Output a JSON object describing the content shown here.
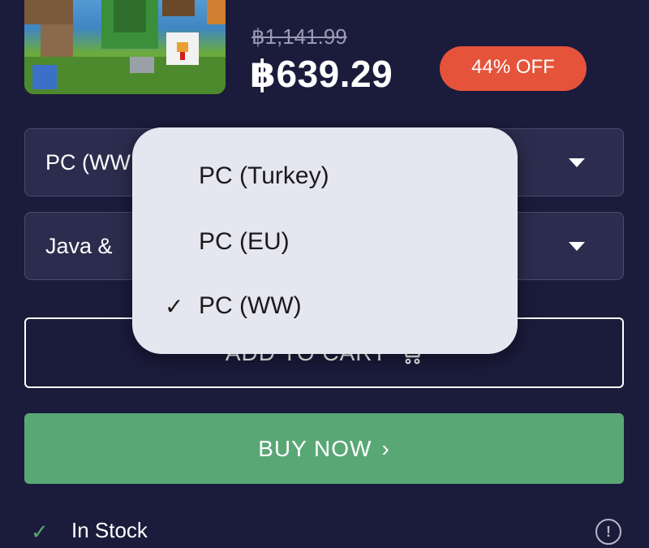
{
  "product": {
    "old_price": "฿1,141.99",
    "price": "฿639.29",
    "discount_label": "44% OFF"
  },
  "platform_select": {
    "value": "PC (WW"
  },
  "edition_select": {
    "value": "Java &"
  },
  "dropdown": {
    "options": [
      {
        "label": "PC (Turkey)",
        "selected": false
      },
      {
        "label": "PC (EU)",
        "selected": false
      },
      {
        "label": "PC (WW)",
        "selected": true
      }
    ],
    "check_mark": "✓"
  },
  "actions": {
    "add_to_cart_label": "ADD TO CART",
    "buy_now_label": "BUY NOW",
    "buy_now_chevron": "›"
  },
  "stock": {
    "check_mark": "✓",
    "label": "In Stock",
    "info_glyph": "!"
  },
  "colors": {
    "background": "#1b1b3c",
    "discount": "#e6533b",
    "buy_now": "#5aa776",
    "popover": "#e6e6f0"
  },
  "icons": {
    "caret": "chevron-down-icon",
    "cart": "cart-icon",
    "info": "info-icon",
    "check": "check-icon"
  }
}
